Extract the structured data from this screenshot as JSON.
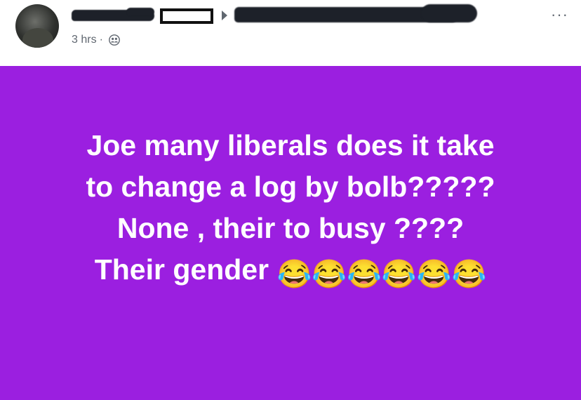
{
  "post": {
    "timestamp": "3 hrs",
    "separator": "·",
    "audience_icon": "friends-icon",
    "more_label": "···",
    "background_color": "#9b1fe0",
    "text_lines": [
      "Joe many liberals does it take",
      "to change a log by bolb?????",
      "None , their to busy ????",
      "Their gender"
    ],
    "emoji": "😂😂😂😂😂😂"
  }
}
